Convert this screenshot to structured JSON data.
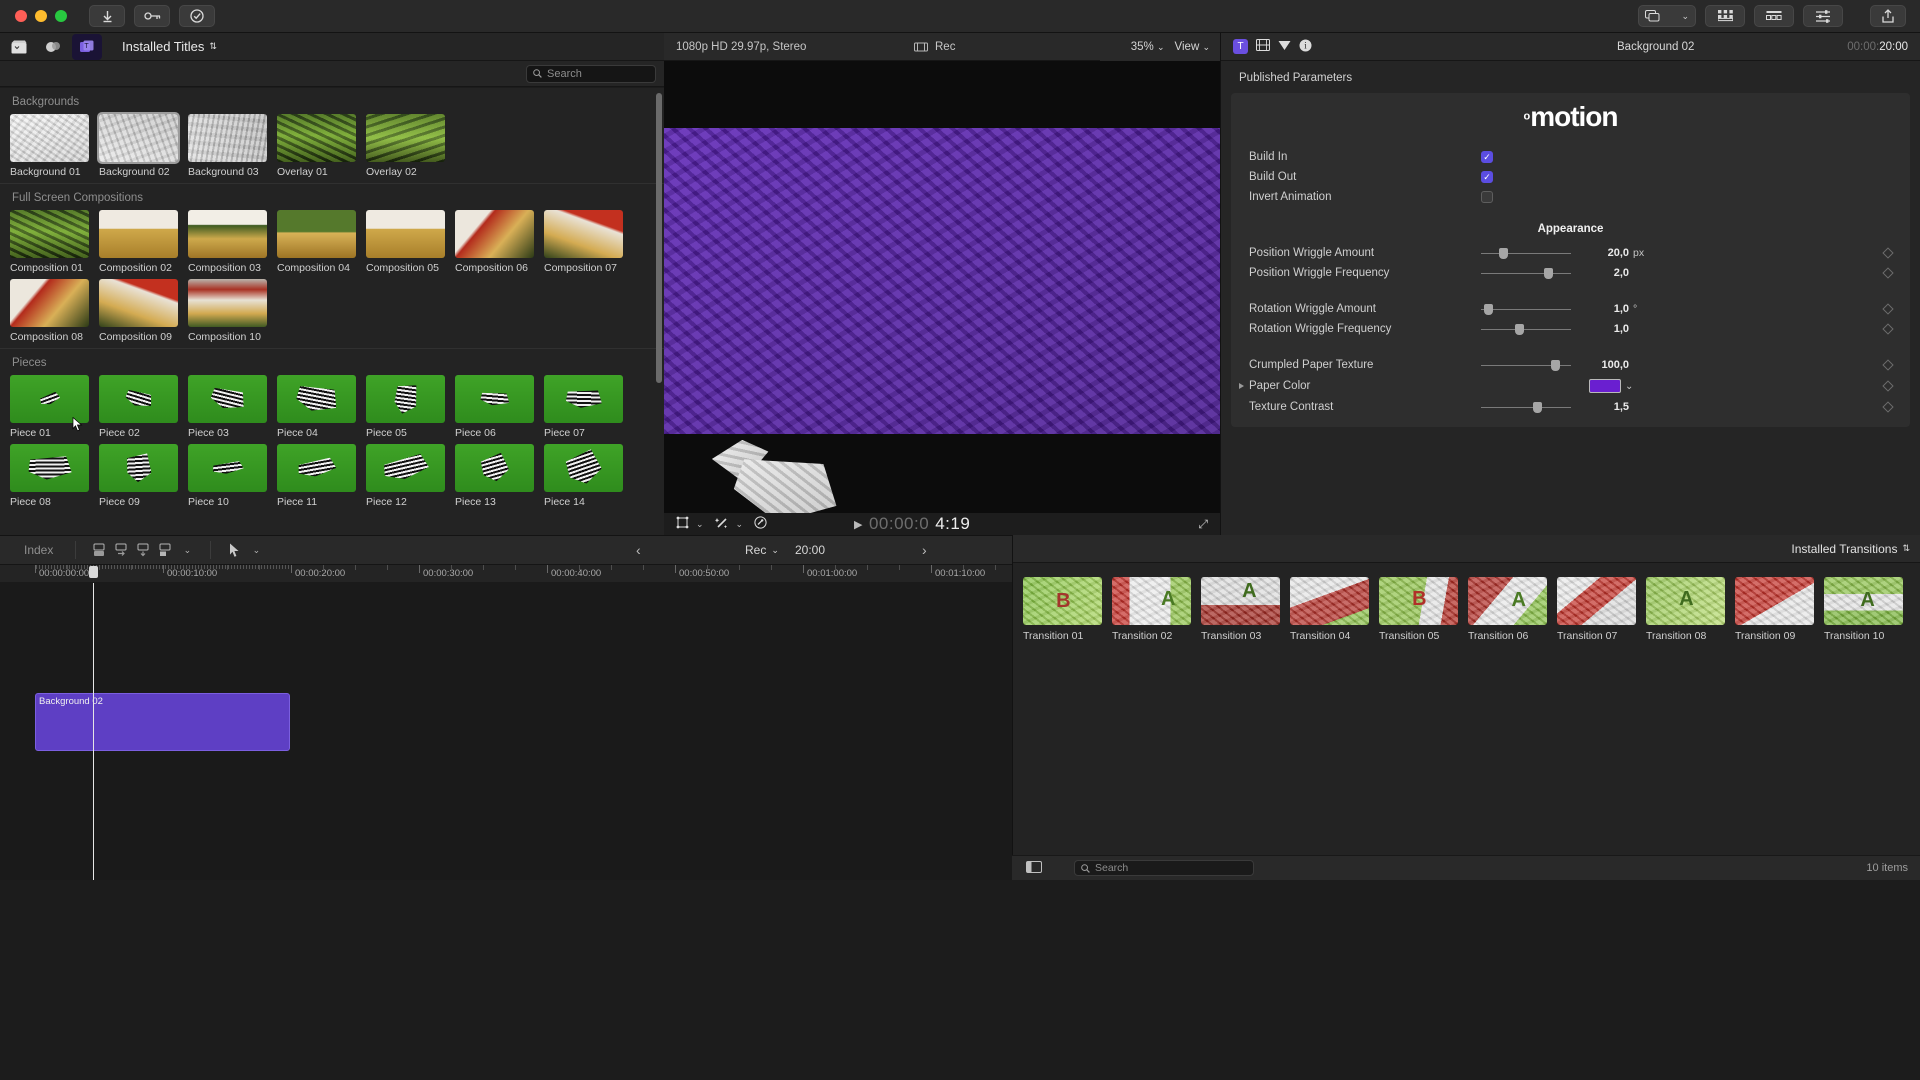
{
  "titlebar": {
    "buttons": [
      {
        "name": "download-button",
        "icon": "↓"
      },
      {
        "name": "keychain-button",
        "icon": "⚷"
      },
      {
        "name": "checkmark-button",
        "icon": "✓"
      }
    ],
    "right_buttons": [
      {
        "name": "screens-button",
        "icon": "🗗"
      },
      {
        "name": "browser-grid-button",
        "icon": "▦"
      },
      {
        "name": "timeline-button",
        "icon": "▤"
      },
      {
        "name": "inspector-button",
        "icon": "⇋"
      },
      {
        "name": "share-button",
        "icon": "⇪"
      }
    ]
  },
  "browser": {
    "tabs": [
      {
        "name": "library-icon",
        "icon": "🎬"
      },
      {
        "name": "effects-icon",
        "icon": "✦"
      },
      {
        "name": "titles-icon",
        "icon": "T"
      }
    ],
    "menu_label": "Installed Titles",
    "search_placeholder": "Search",
    "sections": [
      {
        "title": "Backgrounds",
        "items": [
          {
            "label": "Background 01",
            "tex": "tx-paper1",
            "selected": false
          },
          {
            "label": "Background 02",
            "tex": "tx-paper2",
            "selected": true
          },
          {
            "label": "Background 03",
            "tex": "tx-paper3",
            "selected": false
          },
          {
            "label": "Overlay 01",
            "tex": "tx-moss",
            "selected": false
          },
          {
            "label": "Overlay 02",
            "tex": "tx-moss2",
            "selected": false
          }
        ]
      },
      {
        "title": "Full Screen Compositions",
        "items": [
          {
            "label": "Composition 01",
            "tex": "tx-moss",
            "selected": false
          },
          {
            "label": "Composition 02",
            "tex": "tx-field",
            "selected": false
          },
          {
            "label": "Composition 03",
            "tex": "tx-field2",
            "selected": false
          },
          {
            "label": "Composition 04",
            "tex": "tx-field3",
            "selected": false
          },
          {
            "label": "Composition 05",
            "tex": "tx-field",
            "selected": false
          },
          {
            "label": "Composition 06",
            "tex": "tx-red1",
            "selected": false
          },
          {
            "label": "Composition 07",
            "tex": "tx-red2",
            "selected": false
          },
          {
            "label": "Composition 08",
            "tex": "tx-red1",
            "selected": false
          },
          {
            "label": "Composition 09",
            "tex": "tx-red2",
            "selected": false
          },
          {
            "label": "Composition 10",
            "tex": "tx-red3",
            "selected": false
          }
        ]
      },
      {
        "title": "Pieces",
        "items": [
          {
            "label": "Piece 01",
            "tex": "tx-green",
            "selected": false
          },
          {
            "label": "Piece 02",
            "tex": "tx-green",
            "selected": false
          },
          {
            "label": "Piece 03",
            "tex": "tx-green",
            "selected": false
          },
          {
            "label": "Piece 04",
            "tex": "tx-green",
            "selected": false
          },
          {
            "label": "Piece 05",
            "tex": "tx-green",
            "selected": false
          },
          {
            "label": "Piece 06",
            "tex": "tx-green",
            "selected": false
          },
          {
            "label": "Piece 07",
            "tex": "tx-green",
            "selected": false
          },
          {
            "label": "Piece 08",
            "tex": "tx-green",
            "selected": false
          },
          {
            "label": "Piece 09",
            "tex": "tx-green",
            "selected": false
          },
          {
            "label": "Piece 10",
            "tex": "tx-green",
            "selected": false
          },
          {
            "label": "Piece 11",
            "tex": "tx-green",
            "selected": false
          },
          {
            "label": "Piece 12",
            "tex": "tx-green",
            "selected": false
          },
          {
            "label": "Piece 13",
            "tex": "tx-green",
            "selected": false
          },
          {
            "label": "Piece 14",
            "tex": "tx-green",
            "selected": false
          }
        ]
      }
    ]
  },
  "viewer": {
    "format": "1080p HD 29.97p, Stereo",
    "rec_label": "Rec",
    "zoom": "35%",
    "view_label": "View",
    "timecode_dim": "00:00:0",
    "timecode_lit": "4:19",
    "play_icon": "▶",
    "bottom_icons": [
      {
        "name": "transform-icon",
        "icon": "⬚"
      },
      {
        "name": "chevron-down-icon",
        "icon": "⌄"
      },
      {
        "name": "effects-wand-icon",
        "icon": "✨"
      },
      {
        "name": "chevron-down-icon-2",
        "icon": "⌄"
      },
      {
        "name": "color-balance-icon",
        "icon": "◎"
      }
    ],
    "expand_icon": "⤢"
  },
  "inspector": {
    "title": "Background 02",
    "timecode_dim": "00:00:",
    "timecode_lit": "20:00",
    "tab_icons": [
      {
        "name": "title-inspector-icon",
        "icon": "T",
        "active": true
      },
      {
        "name": "video-inspector-icon",
        "icon": "▤",
        "active": false
      },
      {
        "name": "color-inspector-icon",
        "icon": "▼",
        "active": false
      },
      {
        "name": "info-inspector-icon",
        "icon": "ⓘ",
        "active": false
      }
    ],
    "published_header": "Published Parameters",
    "brand_superscript": "o",
    "brand_name": "motion",
    "appearance_header": "Appearance",
    "checkboxes": [
      {
        "label": "Build In",
        "checked": true
      },
      {
        "label": "Build Out",
        "checked": true
      },
      {
        "label": "Invert Animation",
        "checked": false
      }
    ],
    "params": [
      {
        "label": "Position Wriggle Amount",
        "value": "20,0",
        "unit": "px",
        "knob_pct": 22,
        "group": 1
      },
      {
        "label": "Position Wriggle Frequency",
        "value": "2,0",
        "unit": "",
        "knob_pct": 78,
        "group": 1
      },
      {
        "label": "Rotation Wriggle Amount",
        "value": "1,0",
        "unit": "°",
        "knob_pct": 4,
        "group": 2
      },
      {
        "label": "Rotation Wriggle Frequency",
        "value": "1,0",
        "unit": "",
        "knob_pct": 42,
        "group": 2
      },
      {
        "label": "Crumpled Paper Texture",
        "value": "100,0",
        "unit": "",
        "knob_pct": 86,
        "group": 3
      },
      {
        "label": "Texture Contrast",
        "value": "1,5",
        "unit": "",
        "knob_pct": 64,
        "group": 3
      }
    ],
    "color_param": {
      "label": "Paper Color",
      "swatch": "#6a1fd0",
      "disclosure": "▶",
      "chevron": "⌄"
    }
  },
  "timeline": {
    "index_label": "Index",
    "toolbar_icons": [
      {
        "name": "connect-clip-icon",
        "icon": "⬓"
      },
      {
        "name": "insert-clip-icon",
        "icon": "⬒"
      },
      {
        "name": "append-clip-icon",
        "icon": "⬓"
      },
      {
        "name": "overwrite-clip-icon",
        "icon": "⬒"
      },
      {
        "name": "chevron-down-icon",
        "icon": "⌄"
      },
      {
        "name": "select-tool-icon",
        "icon": "➤"
      },
      {
        "name": "tool-chevron-icon",
        "icon": "⌄"
      }
    ],
    "nav_prev": "‹",
    "nav_next": "›",
    "rec_label": "Rec",
    "duration": "20:00",
    "ruler_labels": [
      "00:00:00:00",
      "00:00:10:00",
      "00:00:20:00",
      "00:00:30:00",
      "00:00:40:00",
      "00:00:50:00",
      "00:01:00:00",
      "00:01:10:00"
    ],
    "clip": {
      "name": "Background 02",
      "color": "#5e3fc4"
    },
    "right_icons": [
      {
        "name": "audio-meters-icon",
        "icon": "▬"
      },
      {
        "name": "audio-waveform-icon",
        "icon": "⩘"
      },
      {
        "name": "headphones-icon",
        "icon": "🎧"
      },
      {
        "name": "clip-appearance-icon",
        "icon": "▬"
      },
      {
        "name": "zoom-level-icon",
        "icon": "▤"
      },
      {
        "name": "index-panel-icon",
        "icon": "▣"
      },
      {
        "name": "close-panel-icon",
        "icon": "◧"
      }
    ]
  },
  "transitions": {
    "menu_label": "Installed Transitions",
    "search_placeholder": "Search",
    "item_count": "10 items",
    "panel_icon": "▣",
    "items": [
      {
        "label": "Transition 01",
        "tex": "trx1",
        "letter": "B",
        "letter_color": "#a3352c",
        "lx": "42%",
        "ly": "28%"
      },
      {
        "label": "Transition 02",
        "tex": "trx2",
        "letter": "A",
        "letter_color": "#4a7a24",
        "lx": "62%",
        "ly": "22%"
      },
      {
        "label": "Transition 03",
        "tex": "trx3",
        "letter": "A",
        "letter_color": "#3f6b1e",
        "lx": "52%",
        "ly": "6%"
      },
      {
        "label": "Transition 04",
        "tex": "trx4",
        "letter": "",
        "letter_color": "#000",
        "lx": "50%",
        "ly": "30%"
      },
      {
        "label": "Transition 05",
        "tex": "trx5",
        "letter": "B",
        "letter_color": "#b03029",
        "lx": "42%",
        "ly": "22%"
      },
      {
        "label": "Transition 06",
        "tex": "trx6",
        "letter": "A",
        "letter_color": "#4a7a24",
        "lx": "55%",
        "ly": "24%"
      },
      {
        "label": "Transition 07",
        "tex": "trx7",
        "letter": "",
        "letter_color": "#000",
        "lx": "50%",
        "ly": "30%"
      },
      {
        "label": "Transition 08",
        "tex": "trx8",
        "letter": "A",
        "letter_color": "#3f6b1e",
        "lx": "42%",
        "ly": "22%"
      },
      {
        "label": "Transition 09",
        "tex": "trx9",
        "letter": "",
        "letter_color": "#000",
        "lx": "50%",
        "ly": "30%"
      },
      {
        "label": "Transition 10",
        "tex": "trx10",
        "letter": "A",
        "letter_color": "#3f6b1e",
        "lx": "46%",
        "ly": "26%"
      }
    ]
  }
}
